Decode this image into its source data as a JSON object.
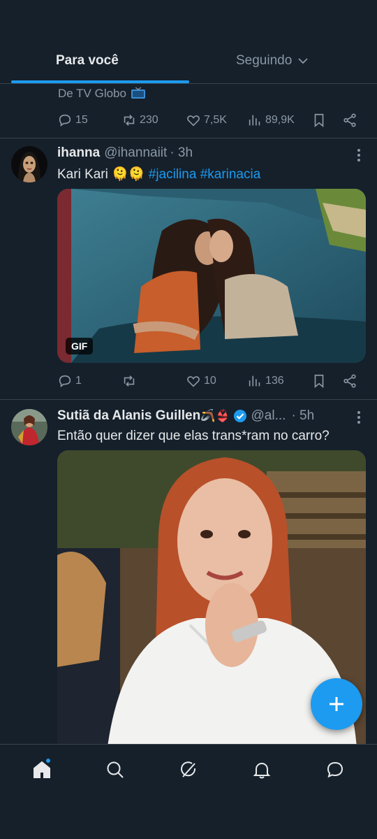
{
  "tabs": {
    "for_you": "Para você",
    "following": "Seguindo"
  },
  "prev_tweet": {
    "source": "De TV Globo",
    "replies": "15",
    "retweets": "230",
    "likes": "7,5K",
    "views": "89,9K"
  },
  "tweet1": {
    "name": "ihanna",
    "handle": "@ihannaiit",
    "time": "· 3h",
    "text": "Kari Kari",
    "emojis": "🫠🫠",
    "hashtag1": "#jacilina",
    "hashtag2": "#karinacia",
    "media_badge": "GIF",
    "replies": "1",
    "retweets": "",
    "likes": "10",
    "views": "136"
  },
  "tweet2": {
    "name": "Sutiã da Alanis Guillen",
    "name_emojis": "🪃👙",
    "handle": "@al...",
    "time": "· 5h",
    "text": "Então quer dizer que elas trans*ram no carro?"
  },
  "nav": {
    "icons": [
      "home-icon",
      "search-icon",
      "grok-icon",
      "bell-icon",
      "messages-icon"
    ]
  },
  "colors": {
    "background": "#15202b",
    "accent": "#1d9bf0",
    "text": "#e7e9ea",
    "muted": "#8b98a5",
    "divider": "#38444d"
  }
}
